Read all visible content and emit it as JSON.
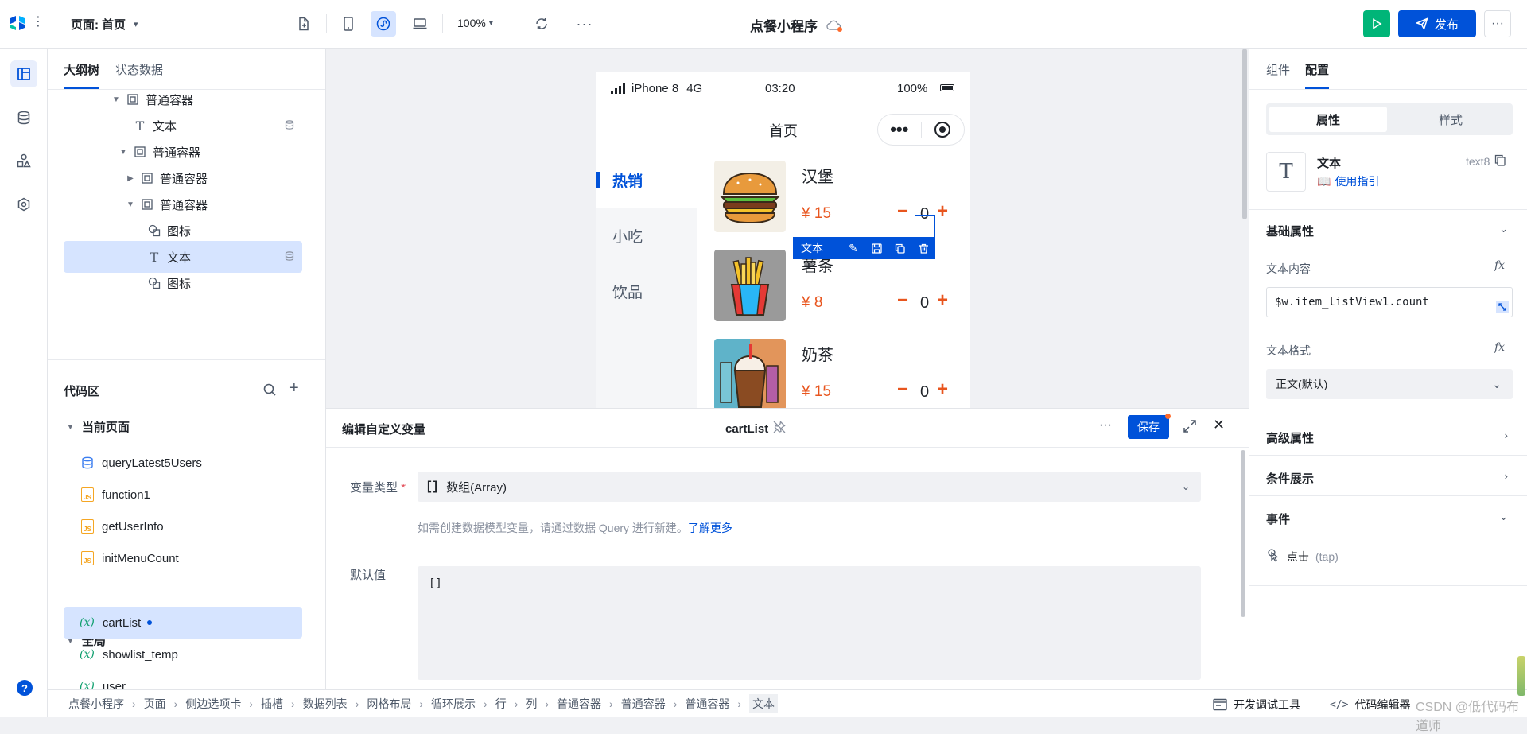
{
  "topbar": {
    "page_label": "页面:",
    "page_name": "首页",
    "zoom": "100%",
    "app_title": "点餐小程序",
    "publish_label": "发布"
  },
  "left_panel": {
    "tabs": [
      "大纲树",
      "状态数据"
    ],
    "tree": [
      {
        "label": "普通容器",
        "icon": "container-icon",
        "indent": 1,
        "caret": "down"
      },
      {
        "label": "文本",
        "icon": "text-icon",
        "indent": 2,
        "caret": "",
        "db": true
      },
      {
        "label": "普通容器",
        "icon": "container-icon",
        "indent": 2,
        "caret": "down"
      },
      {
        "label": "普通容器",
        "icon": "container-icon",
        "indent": 3,
        "caret": "right"
      },
      {
        "label": "普通容器",
        "icon": "container-icon",
        "indent": 3,
        "caret": "down"
      },
      {
        "label": "图标",
        "icon": "shapes-icon",
        "indent": 4,
        "caret": ""
      },
      {
        "label": "文本",
        "icon": "text-icon",
        "indent": 4,
        "caret": "",
        "db": true,
        "selected": true
      },
      {
        "label": "图标",
        "icon": "shapes-icon",
        "indent": 4,
        "caret": ""
      }
    ],
    "code_title": "代码区",
    "current_page_label": "当前页面",
    "current_page_items": [
      {
        "label": "queryLatest5Users",
        "icon": "database-icon"
      },
      {
        "label": "function1",
        "icon": "js-file-icon"
      },
      {
        "label": "getUserInfo",
        "icon": "js-file-icon"
      },
      {
        "label": "initMenuCount",
        "icon": "js-file-icon"
      }
    ],
    "global_label": "全局",
    "global_items": [
      {
        "label": "cartList",
        "selected": true,
        "dot": true
      },
      {
        "label": "showlist_temp"
      },
      {
        "label": "user"
      }
    ],
    "var_icon": "(x)"
  },
  "phone": {
    "carrier": "iPhone 8",
    "network": "4G",
    "time": "03:20",
    "battery": "100%",
    "nav_title": "首页",
    "categories": [
      {
        "label": "热销",
        "active": true
      },
      {
        "label": "小吃"
      },
      {
        "label": "饮品"
      }
    ],
    "items": [
      {
        "name": "汉堡",
        "price": "¥ 15",
        "count": "0",
        "image": "burger-image"
      },
      {
        "name": "薯条",
        "price": "¥ 8",
        "count": "0",
        "image": "fries-image"
      },
      {
        "name": "奶茶",
        "price": "¥ 15",
        "count": "0",
        "image": "milk-tea-image"
      }
    ],
    "minus": "−",
    "plus": "+",
    "selection_label": "文本"
  },
  "editor": {
    "title": "编辑自定义变量",
    "var_name": "cartList",
    "save_label": "保存",
    "type_label": "变量类型",
    "required_mark": "*",
    "type_value": "数组(Array)",
    "hint_text": "如需创建数据模型变量，请通过数据 Query 进行新建。",
    "learn_more": "了解更多",
    "default_label": "默认值",
    "default_value": "[]"
  },
  "right_panel": {
    "tabs": [
      "组件",
      "配置"
    ],
    "segment": [
      "属性",
      "样式"
    ],
    "component_name": "文本",
    "component_id": "text8",
    "guide_label": "使用指引",
    "basic_props": "基础属性",
    "text_content_label": "文本内容",
    "text_content_value": "$w.item_listView1.count",
    "text_format_label": "文本格式",
    "text_format_value": "正文(默认)",
    "advanced_props": "高级属性",
    "conditional": "条件展示",
    "events": "事件",
    "event_item": "点击",
    "event_item_sub": "(tap)",
    "fx": "fx"
  },
  "bottombar": {
    "breadcrumb": [
      "点餐小程序",
      "页面",
      "侧边选项卡",
      "插槽",
      "数据列表",
      "网格布局",
      "循环展示",
      "行",
      "列",
      "普通容器",
      "普通容器",
      "普通容器",
      "文本"
    ],
    "dev_tools": "开发调试工具",
    "code_editor": "代码编辑器",
    "watermark": "CSDN @低代码布道师"
  },
  "colors": {
    "accent": "#0052d9",
    "price": "#e8551e",
    "green": "#00b578"
  }
}
